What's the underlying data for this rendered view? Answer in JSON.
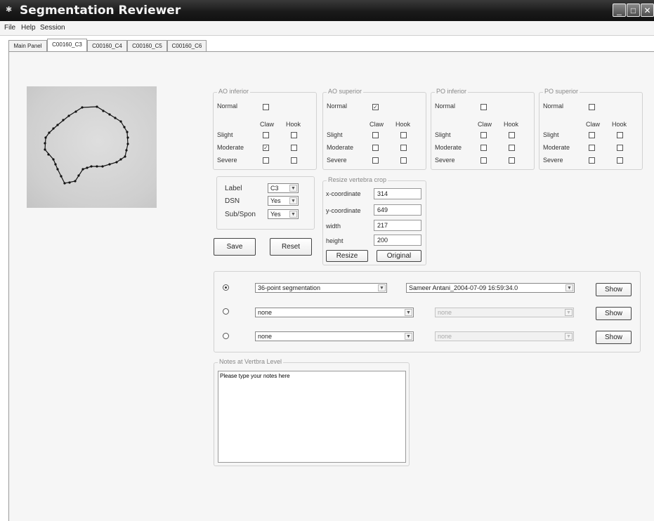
{
  "window": {
    "title": "Segmentation Reviewer",
    "icon": "app-icon",
    "controls": {
      "minimize": "_",
      "maximize": "□",
      "close": "✕"
    }
  },
  "menu": {
    "items": [
      "File",
      "Help",
      "Session"
    ]
  },
  "tabs": [
    {
      "label": "Main Panel",
      "active": false
    },
    {
      "label": "C00160_C3",
      "active": true
    },
    {
      "label": "C00160_C4",
      "active": false
    },
    {
      "label": "C00160_C5",
      "active": false
    },
    {
      "label": "C00160_C6",
      "active": false
    }
  ],
  "groups": {
    "ao_inferior": {
      "title": "AO inferior",
      "normal_checked": false,
      "checked": {
        "slight_claw": false,
        "slight_hook": false,
        "moderate_claw": true,
        "moderate_hook": false,
        "severe_claw": false,
        "severe_hook": false
      }
    },
    "ao_superior": {
      "title": "AO superior",
      "normal_checked": true,
      "checked": {
        "slight_claw": false,
        "slight_hook": false,
        "moderate_claw": false,
        "moderate_hook": false,
        "severe_claw": false,
        "severe_hook": false
      }
    },
    "po_inferior": {
      "title": "PO inferior",
      "normal_checked": false,
      "checked": {
        "slight_claw": false,
        "slight_hook": false,
        "moderate_claw": false,
        "moderate_hook": false,
        "severe_claw": false,
        "severe_hook": false
      }
    },
    "po_superior": {
      "title": "PO superior",
      "normal_checked": false,
      "checked": {
        "slight_claw": false,
        "slight_hook": false,
        "moderate_claw": false,
        "moderate_hook": false,
        "severe_claw": false,
        "severe_hook": false
      }
    },
    "row_labels": {
      "normal": "Normal",
      "claw": "Claw",
      "hook": "Hook",
      "slight": "Slight",
      "moderate": "Moderate",
      "severe": "Severe"
    }
  },
  "label_panel": {
    "label": {
      "text": "Label",
      "value": "C3"
    },
    "dsn": {
      "text": "DSN",
      "value": "Yes"
    },
    "subspon": {
      "text": "Sub/Spon",
      "value": "Yes"
    },
    "save": "Save",
    "reset": "Reset"
  },
  "resize_panel": {
    "title": "Resize vertebra crop",
    "x_label": "x-coordinate",
    "x_value": "314",
    "y_label": "y-coordinate",
    "y_value": "649",
    "width_label": "width",
    "width_value": "217",
    "height_label": "height",
    "height_value": "200",
    "resize": "Resize",
    "original": "Original"
  },
  "segmentation_rows": [
    {
      "selected": true,
      "method": "36-point segmentation",
      "user": "Sameer Antani_2004-07-09 16:59:34.0",
      "user_enabled": true,
      "show": "Show"
    },
    {
      "selected": false,
      "method": "none",
      "user": "none",
      "user_enabled": false,
      "show": "Show"
    },
    {
      "selected": false,
      "method": "none",
      "user": "none",
      "user_enabled": false,
      "show": "Show"
    }
  ],
  "notes": {
    "title": "Notes at Vertbra Level",
    "value": "Please type your notes here"
  },
  "colors": {
    "titlebar": "#1a1a1a",
    "panel_bg": "#f6f6f6",
    "border": "#d2d2d2",
    "contour": "#111111"
  }
}
